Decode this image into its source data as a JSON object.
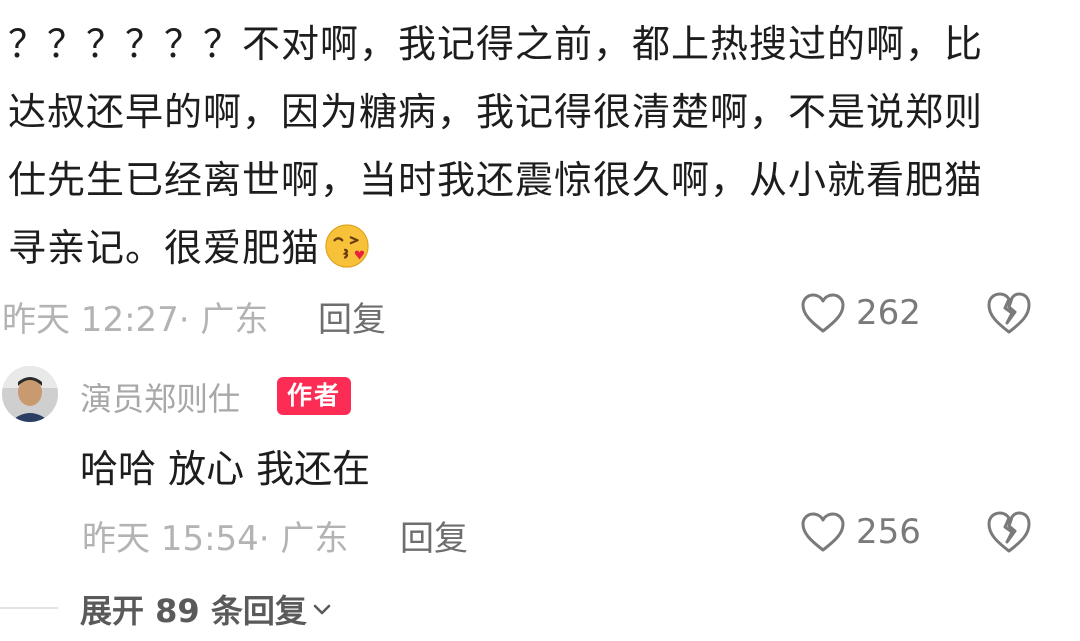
{
  "comment": {
    "text": "？？？？？？不对啊，我记得之前，都上热搜过的啊，比达叔还早的啊，因为糖病，我记得很清楚啊，不是说郑则仕先生已经离世啊，当时我还震惊很久啊，从小就看肥猫寻亲记。很爱肥猫",
    "emoji": "kiss-face-emoji",
    "time_location": "昨天 12:27· 广东",
    "reply_label": "回复",
    "likes": "262"
  },
  "author_reply": {
    "author": "演员郑则仕",
    "badge": "作者",
    "text": "哈哈 放心 我还在",
    "time_location": "昨天 15:54· 广东",
    "reply_label": "回复",
    "likes": "256"
  },
  "expand": {
    "label": "展开 89 条回复"
  },
  "colors": {
    "badge": "#fc2c55",
    "meta": "#b3b3b3",
    "text": "#1d1d1d"
  }
}
